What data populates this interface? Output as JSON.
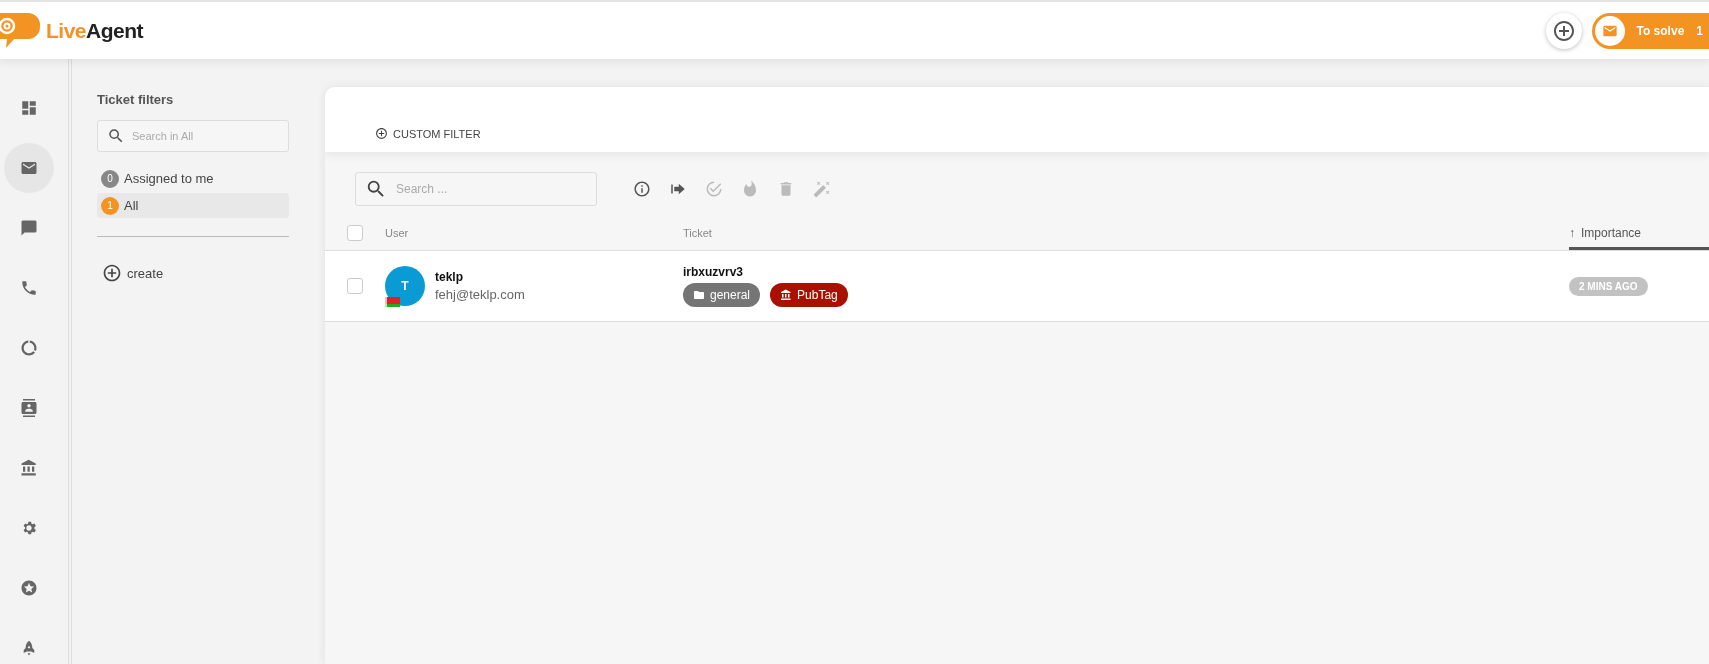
{
  "header": {
    "brand_first": "Live",
    "brand_second": "Agent",
    "to_solve": {
      "label": "To solve",
      "count": "1"
    }
  },
  "nav": [
    {
      "kind": "dashboard",
      "selected": false
    },
    {
      "kind": "mail",
      "selected": true
    },
    {
      "kind": "chat",
      "selected": false
    },
    {
      "kind": "phone",
      "selected": false
    },
    {
      "kind": "reports",
      "selected": false
    },
    {
      "kind": "contacts",
      "selected": false
    },
    {
      "kind": "bank",
      "selected": false
    },
    {
      "kind": "settings",
      "selected": false
    },
    {
      "kind": "star",
      "selected": false
    },
    {
      "kind": "rocket",
      "selected": false
    }
  ],
  "filters": {
    "title": "Ticket filters",
    "search": {
      "placeholder": "Search in All"
    },
    "items": [
      {
        "count": "0",
        "label": "Assigned to me",
        "selected": false
      },
      {
        "count": "1",
        "label": "All",
        "selected": true
      }
    ],
    "create": "create"
  },
  "main": {
    "custom_filter": "CUSTOM FILTER",
    "search": {
      "placeholder": "Search ..."
    },
    "toolbar": [
      {
        "kind": "info",
        "disabled": false
      },
      {
        "kind": "forward",
        "disabled": false
      },
      {
        "kind": "resolve",
        "disabled": true
      },
      {
        "kind": "fire",
        "disabled": true
      },
      {
        "kind": "delete",
        "disabled": true
      },
      {
        "kind": "magic",
        "disabled": true
      }
    ],
    "select_all": {
      "checked": false
    },
    "columns": [
      {
        "label": "User",
        "sorted": false
      },
      {
        "label": "Ticket",
        "sorted": false
      },
      {
        "label": "Importance",
        "sorted": true,
        "sort_mark": "↑"
      }
    ],
    "rows": [
      {
        "checked": false,
        "avatar": "T",
        "name": "teklp",
        "email": "fehj@teklp.com",
        "subject": "irbxuzvrv3",
        "tags": [
          {
            "kind": "department",
            "label": "general",
            "color": "#757575"
          },
          {
            "kind": "tag",
            "label": "PubTag",
            "color": "#a91000"
          }
        ],
        "time": "2 MINS AGO"
      }
    ]
  }
}
